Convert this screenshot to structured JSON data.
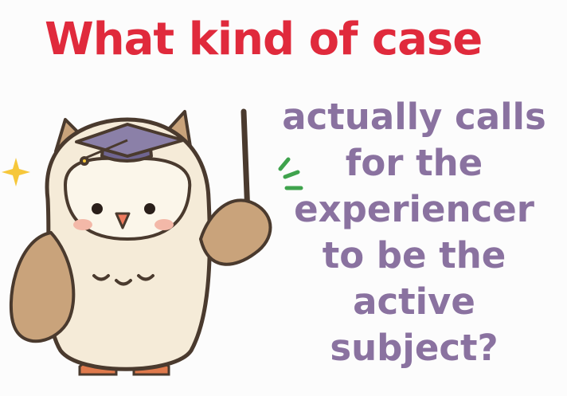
{
  "title": "What kind of case",
  "question_lines": [
    "actually calls",
    "for the",
    "experiencer",
    "to be the",
    "active",
    "subject?"
  ],
  "illustration": {
    "subject": "owl-teacher",
    "icons": [
      "graduation-cap-icon",
      "pointer-stick-icon",
      "sparkle-icon",
      "emphasis-lines-icon"
    ]
  },
  "colors": {
    "title": "#e02a3c",
    "question": "#8a72a0",
    "owl_body": "#f5ebd8",
    "owl_wing": "#c9a37b",
    "cap": "#8b80a8",
    "sparkle": "#f6c73a",
    "emphasis": "#3fa34d"
  }
}
